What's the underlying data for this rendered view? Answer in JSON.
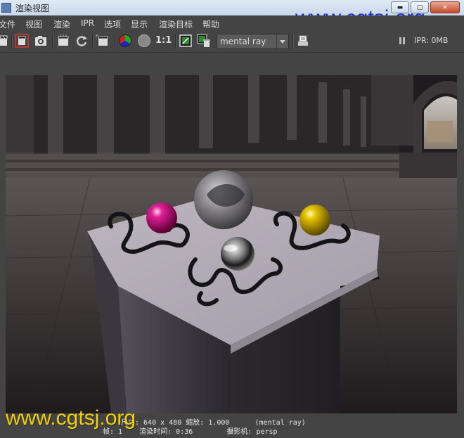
{
  "window": {
    "title": "渲染视图",
    "controls": {
      "minimize": "▬",
      "maximize": "▢",
      "close": "✕"
    }
  },
  "watermark": {
    "text": "www.cgtsj.org",
    "color_top": "#1f2fe0",
    "color_bottom": "#f2d200"
  },
  "menubar": {
    "items": [
      "文件",
      "视图",
      "渲染",
      "IPR",
      "选项",
      "显示",
      "渲染目标",
      "帮助"
    ]
  },
  "toolbar": {
    "icons": [
      "redo-render-icon",
      "render-region-icon",
      "snapshot-icon",
      "ipr-render-icon",
      "refresh-icon",
      "ipr-region-icon",
      "rgb-channels-icon",
      "alpha-channel-icon",
      "real-size-icon",
      "keep-image-icon",
      "remove-image-icon",
      "render-settings-icon"
    ],
    "real_size_label": "1:1",
    "renderer_selected": "mental ray",
    "ipr_memory": "IPR: 0MB"
  },
  "status": {
    "line1": "尺寸: 640 x 480 缩放: 1.000      (mental ray)",
    "line2": "帧: 1    渲染时间: 0:36        摄影机: persp"
  },
  "colors": {
    "ui_background": "#444444",
    "magenta_ball": "#d4127a",
    "yellow_ball": "#e4c000",
    "platform": "#bfbac4"
  }
}
